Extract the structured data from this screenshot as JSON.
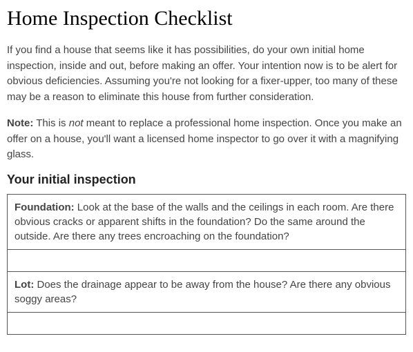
{
  "title": "Home Inspection Checklist",
  "intro": "If you find a house that seems like it has possibilities, do your own initial home inspection, inside and out, before making an offer. Your intention now is to be alert for obvious deficiencies. Assuming you're not looking for a fixer-upper, too many of these may be a reason to eliminate this house from further consideration.",
  "note_label": "Note:",
  "note_prefix": " This is ",
  "note_italic": "not",
  "note_suffix": " meant to replace a professional home inspection. Once you make an offer on a house, you'll want a licensed home inspector to go over it with a magnifying glass.",
  "section_heading": "Your initial inspection",
  "rows": {
    "r0_label": "Foundation:",
    "r0_text": " Look at the base of the walls and the ceilings in each room. Are there obvious cracks or apparent shifts in the foundation? Do the same around the outside. Are there any trees encroaching on the foundation?",
    "r1_text": "",
    "r2_label": "Lot:",
    "r2_text": " Does the drainage appear to be away from the house? Are there any obvious soggy areas?",
    "r3_text": ""
  }
}
